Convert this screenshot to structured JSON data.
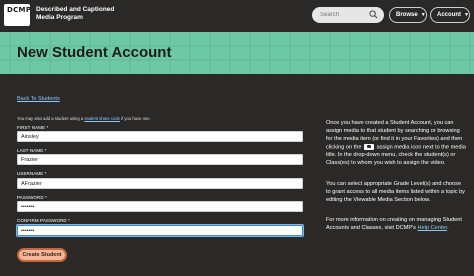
{
  "header": {
    "logo_text": "DCMP",
    "brand_line1": "Described and Captioned",
    "brand_line2": "Media Program",
    "search_placeholder": "Search",
    "browse_label": "Browse",
    "account_label": "Account"
  },
  "hero": {
    "title": "New Student Account"
  },
  "main": {
    "back_link": "Back To Students",
    "intro_before": "You may also add a student using a ",
    "intro_link": "student share code",
    "intro_after": " if you have one.",
    "fields": [
      {
        "label": "FIRST NAME *",
        "value": "Ainsley"
      },
      {
        "label": "LAST NAME *",
        "value": "Frazier"
      },
      {
        "label": "USERNAME *",
        "value": "AFrazier"
      },
      {
        "label": "PASSWORD *",
        "value": "•••••••"
      },
      {
        "label": "CONFIRM PASSWORD *",
        "value": "•••••••"
      }
    ],
    "create_button": "Create Student"
  },
  "side": {
    "p1_before": "Once you have created a Student Account, you can assign media to that student by searching or browsing for the media item (or find it in your Favorites) and then clicking on the",
    "p1_after": "assign media icon next to the media title. In the drop-down menu, check the student(s) or Class(es) to whom you wish to assign the video.",
    "p2": "You can select appropriate Grade Level(s) and choose to grant access to all media items listed within a topic by editing the Viewable Media Section below.",
    "p3_before": "For more information on creating on managing Student Accounts and Classes, visit DCMP's ",
    "p3_link": "Help Center",
    "p3_after": "."
  },
  "colors": {
    "background": "#2b2927",
    "hero": "#6dc9a5",
    "link": "#8fc6ff",
    "button": "#f6b69a",
    "button_border": "#c4673c"
  }
}
